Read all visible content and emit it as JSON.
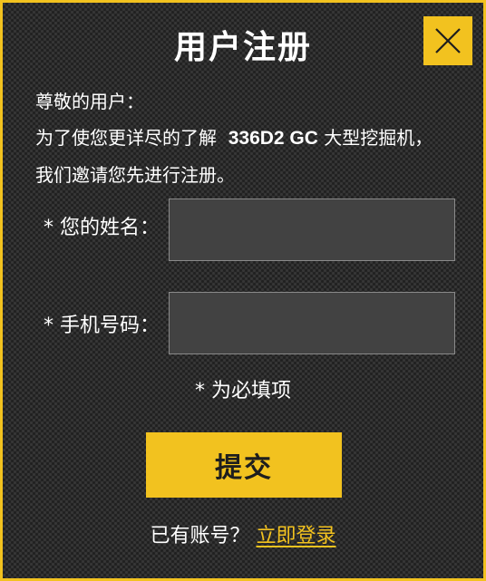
{
  "dialog": {
    "title": "用户注册",
    "close_icon": "close-icon",
    "accent_color": "#f2c21f"
  },
  "intro": {
    "greeting": "尊敬的用户：",
    "line2_prefix": "为了使您更详尽的了解",
    "model": "336D2 GC",
    "line2_suffix": "大型挖掘机，",
    "line3": "我们邀请您先进行注册。"
  },
  "form": {
    "name_label": "* 您的姓名：",
    "name_value": "",
    "phone_label": "* 手机号码：",
    "phone_value": "",
    "required_note": "* 为必填项",
    "submit_label": "提交"
  },
  "footer": {
    "has_account_text": "已有账号？",
    "login_link": "立即登录"
  }
}
